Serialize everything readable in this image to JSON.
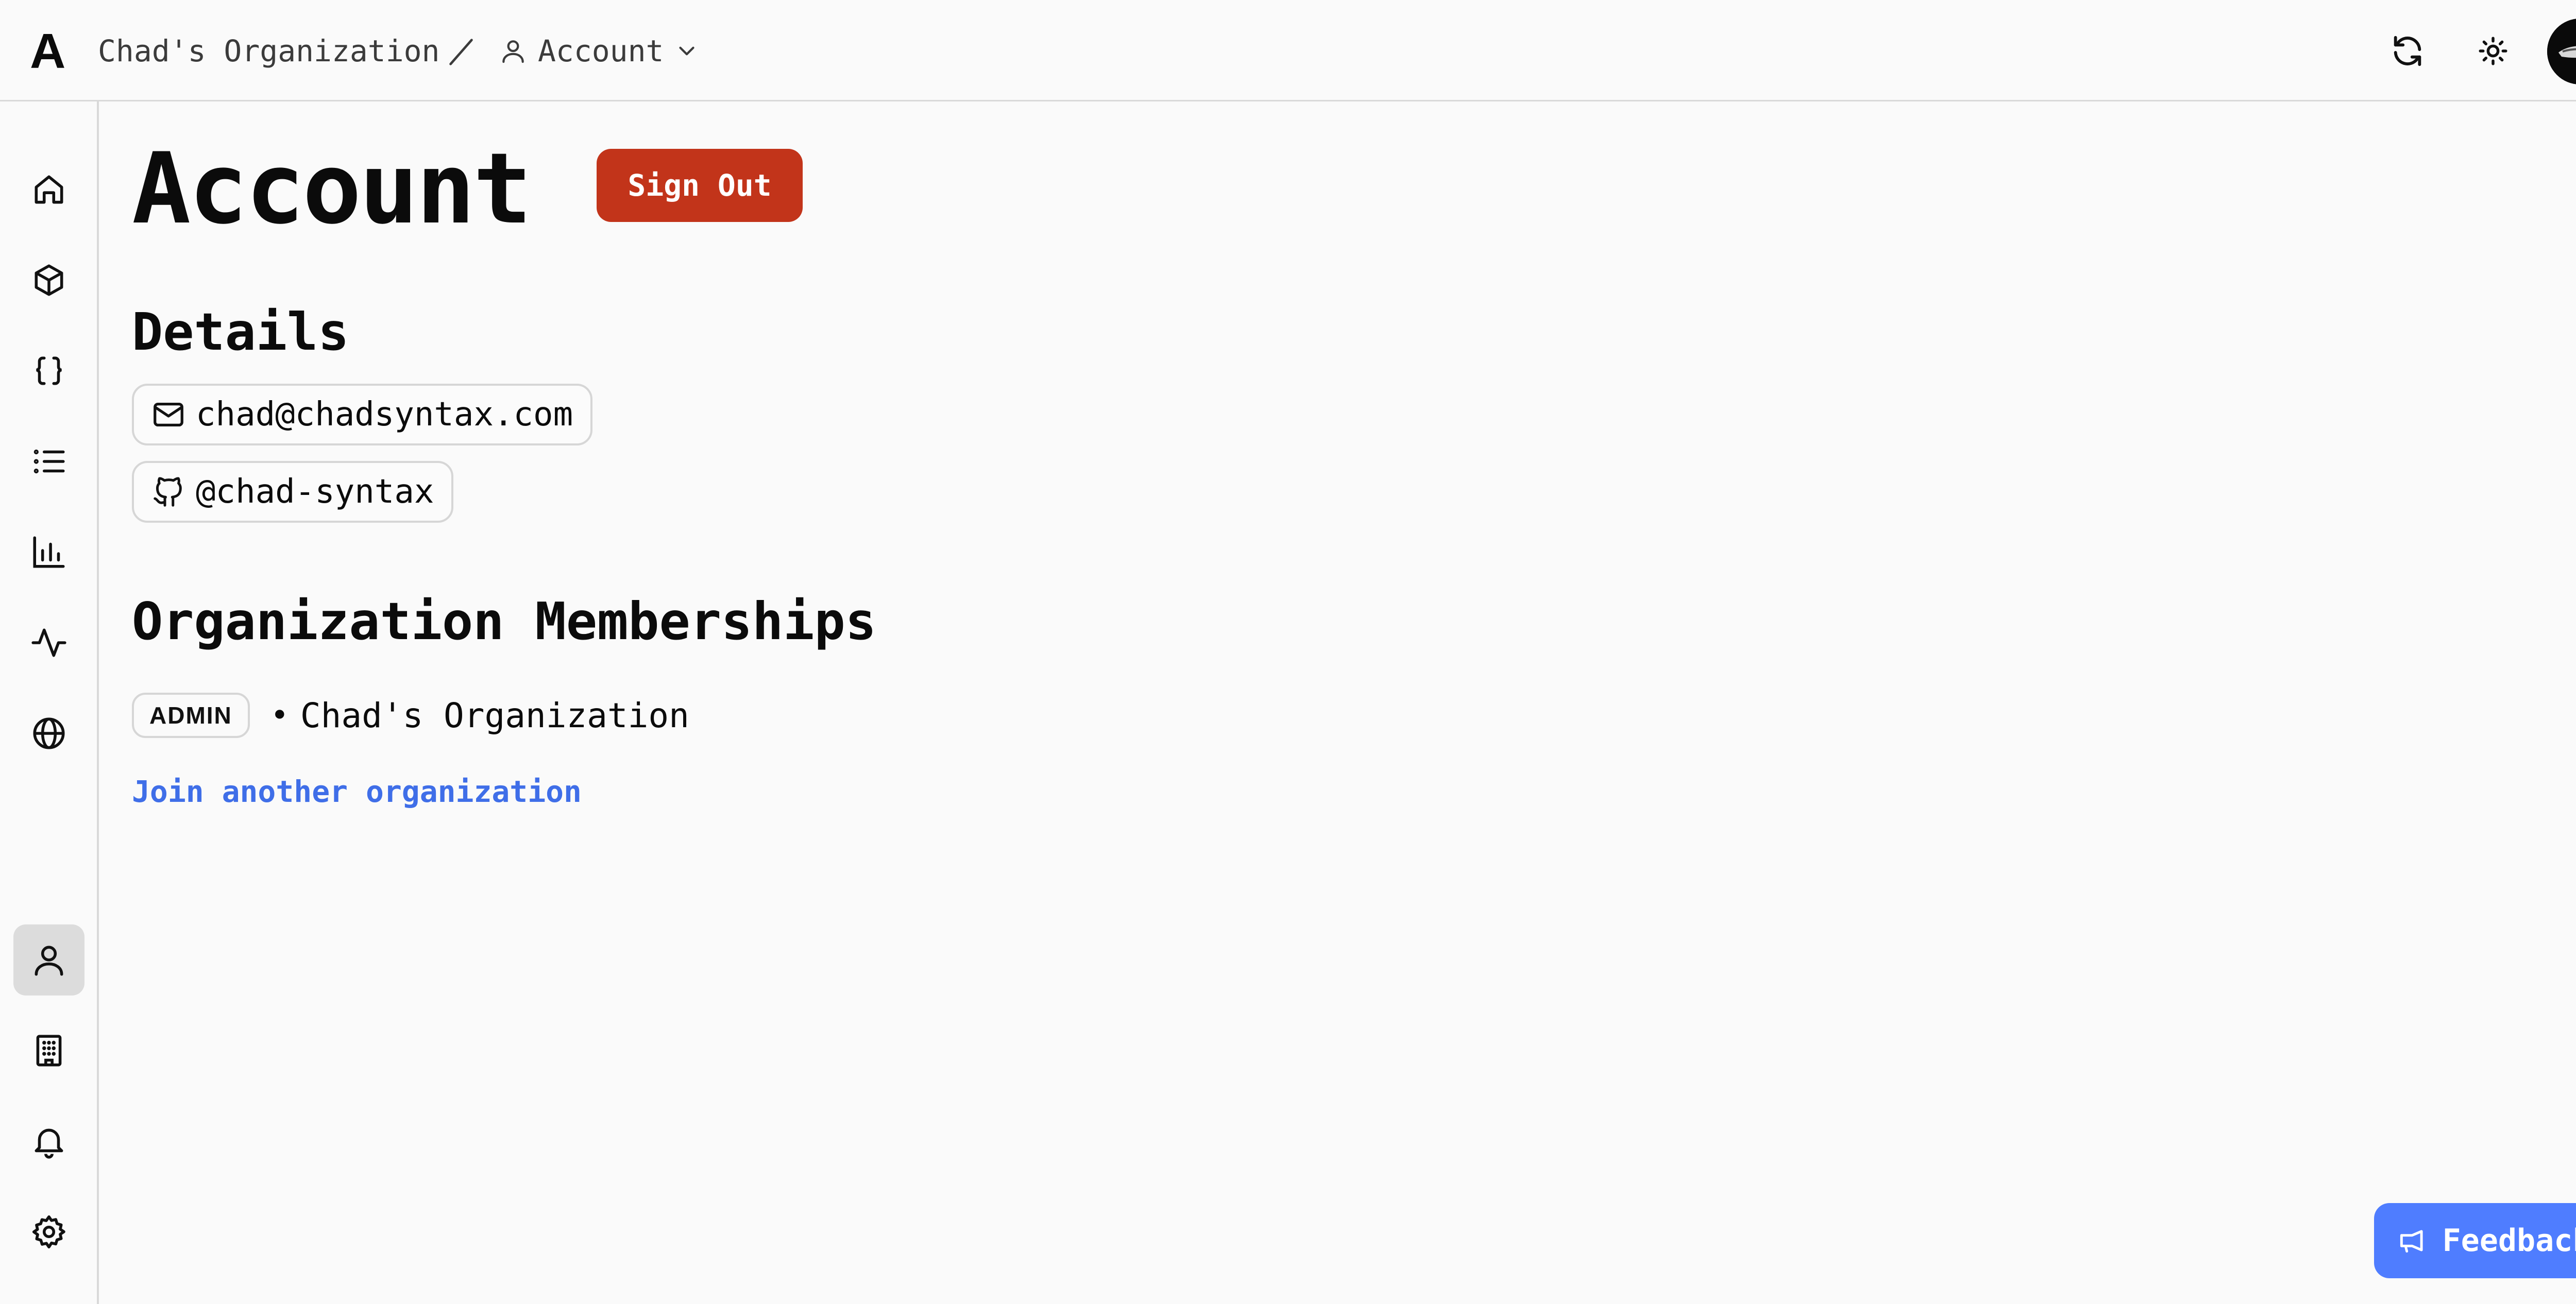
{
  "topbar": {
    "logo": "A",
    "org_name": "Chad's Organization",
    "account_label": "Account",
    "icons": [
      "refresh-icon",
      "sun-icon",
      "avatar"
    ]
  },
  "sidebar": {
    "items": [
      {
        "name": "home",
        "icon": "home-icon",
        "active": false
      },
      {
        "name": "packages",
        "icon": "cube-icon",
        "active": false
      },
      {
        "name": "code",
        "icon": "braces-icon",
        "active": false
      },
      {
        "name": "list",
        "icon": "list-icon",
        "active": false
      },
      {
        "name": "analytics",
        "icon": "bar-chart-icon",
        "active": false
      },
      {
        "name": "activity",
        "icon": "activity-icon",
        "active": false
      },
      {
        "name": "globe",
        "icon": "globe-icon",
        "active": false
      },
      {
        "name": "account",
        "icon": "user-icon",
        "active": true
      },
      {
        "name": "organization",
        "icon": "building-icon",
        "active": false
      },
      {
        "name": "notifications",
        "icon": "bell-icon",
        "active": false
      },
      {
        "name": "settings",
        "icon": "gear-icon",
        "active": false
      }
    ]
  },
  "main": {
    "title": "Account",
    "sign_out_label": "Sign Out",
    "details_heading": "Details",
    "email": "chad@chadsyntax.com",
    "github": "@chad-syntax",
    "memberships_heading": "Organization Memberships",
    "membership": {
      "role": "ADMIN",
      "bullet": "•",
      "org": "Chad's Organization"
    },
    "join_link": "Join another organization"
  },
  "feedback_label": "Feedback",
  "colors": {
    "danger": "#c2341a",
    "link": "#3f6ee8",
    "feedback": "#4f7dff"
  }
}
